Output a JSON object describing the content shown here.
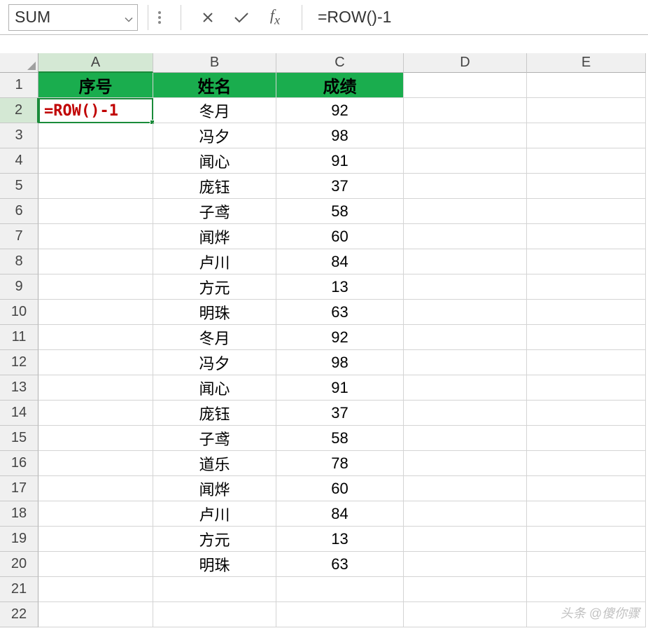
{
  "formula_bar": {
    "name_box": "SUM",
    "formula_input": "=ROW()-1"
  },
  "columns": [
    "A",
    "B",
    "C",
    "D",
    "E"
  ],
  "row_numbers": [
    1,
    2,
    3,
    4,
    5,
    6,
    7,
    8,
    9,
    10,
    11,
    12,
    13,
    14,
    15,
    16,
    17,
    18,
    19,
    20,
    21,
    22
  ],
  "active_cell": {
    "col": "A",
    "row": 2
  },
  "header_row": {
    "a": "序号",
    "b": "姓名",
    "c": "成绩"
  },
  "edit_cell_display": "=ROW()-1",
  "data_rows": [
    {
      "b": "冬月",
      "c": "92"
    },
    {
      "b": "冯夕",
      "c": "98"
    },
    {
      "b": "闻心",
      "c": "91"
    },
    {
      "b": "庞钰",
      "c": "37"
    },
    {
      "b": "子鸢",
      "c": "58"
    },
    {
      "b": "闻烨",
      "c": "60"
    },
    {
      "b": "卢川",
      "c": "84"
    },
    {
      "b": "方元",
      "c": "13"
    },
    {
      "b": "明珠",
      "c": "63"
    },
    {
      "b": "冬月",
      "c": "92"
    },
    {
      "b": "冯夕",
      "c": "98"
    },
    {
      "b": "闻心",
      "c": "91"
    },
    {
      "b": "庞钰",
      "c": "37"
    },
    {
      "b": "子鸢",
      "c": "58"
    },
    {
      "b": "道乐",
      "c": "78"
    },
    {
      "b": "闻烨",
      "c": "60"
    },
    {
      "b": "卢川",
      "c": "84"
    },
    {
      "b": "方元",
      "c": "13"
    },
    {
      "b": "明珠",
      "c": "63"
    }
  ],
  "watermark": "头条 @傻你骤"
}
